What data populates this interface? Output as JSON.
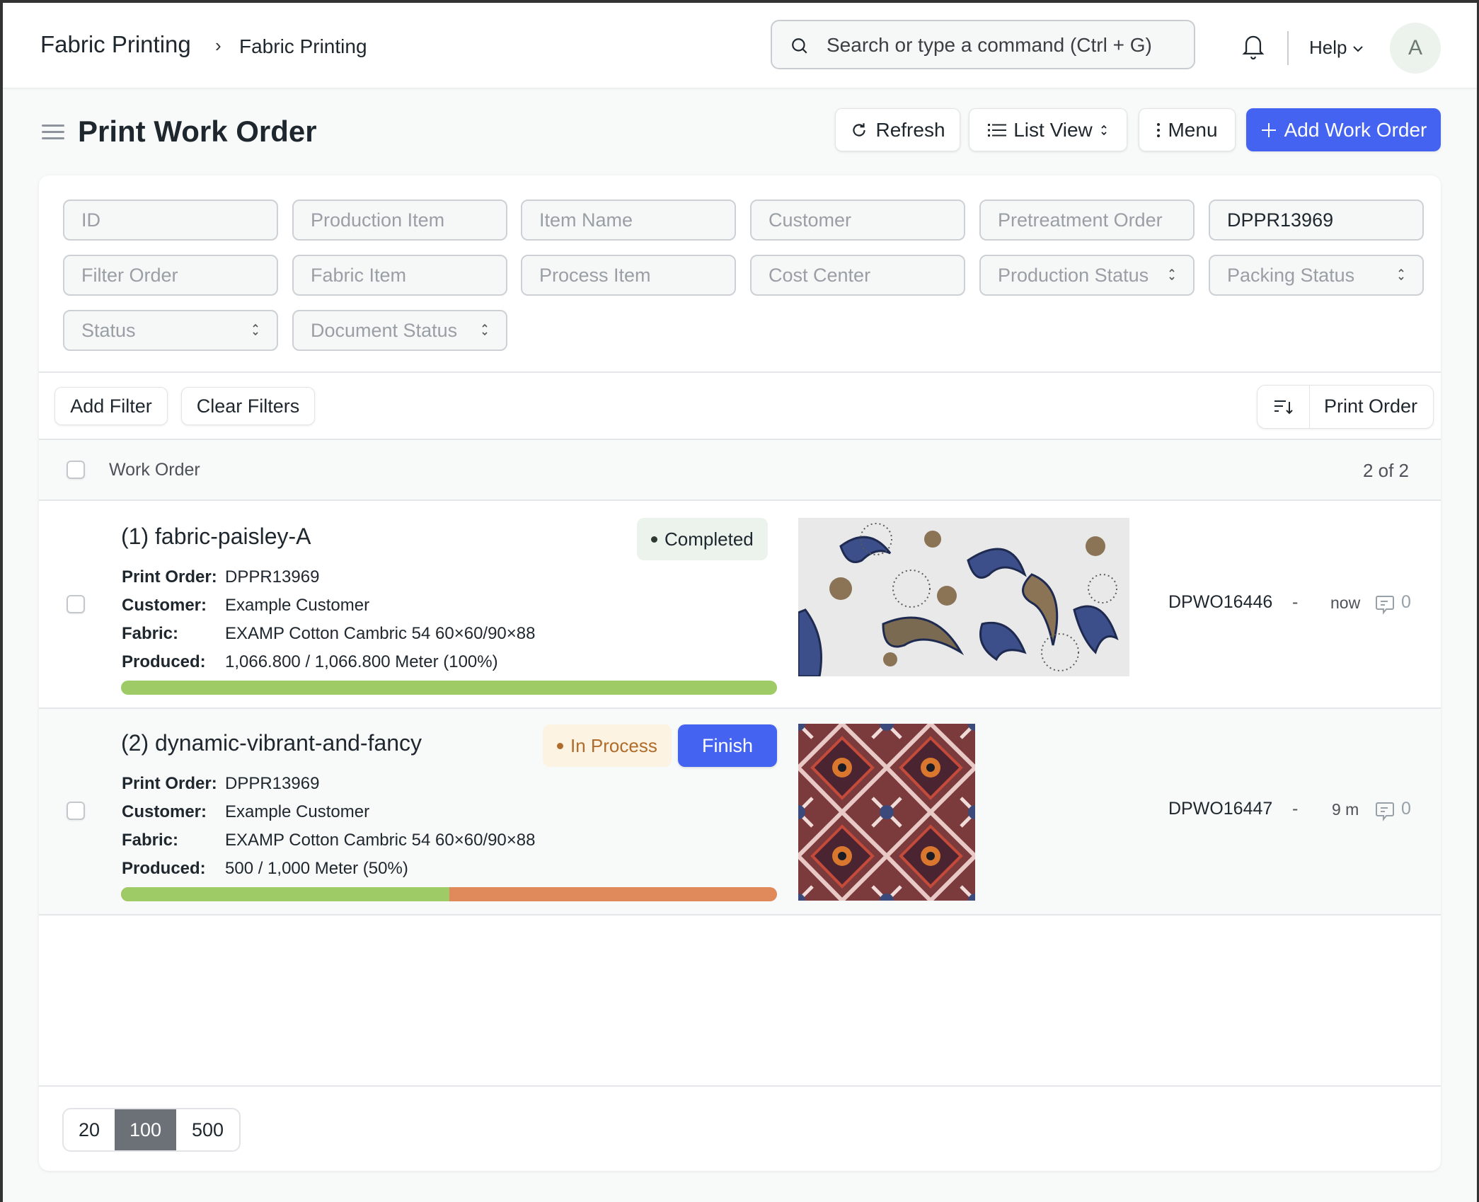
{
  "navbar": {
    "breadcrumbs": [
      "Fabric Printing",
      "Fabric Printing"
    ],
    "breadcrumb_separator": "›",
    "search_placeholder": "Search or type a command (Ctrl + G)",
    "help_label": "Help",
    "avatar_initial": "A"
  },
  "page": {
    "title": "Print Work Order",
    "buttons": {
      "refresh": "Refresh",
      "list_view": "List View",
      "menu": "Menu",
      "add": "Add Work Order"
    }
  },
  "filters": {
    "fields": [
      {
        "placeholder": "ID",
        "value": "",
        "type": "text"
      },
      {
        "placeholder": "Production Item",
        "value": "",
        "type": "text"
      },
      {
        "placeholder": "Item Name",
        "value": "",
        "type": "text"
      },
      {
        "placeholder": "Customer",
        "value": "",
        "type": "text"
      },
      {
        "placeholder": "Pretreatment Order",
        "value": "",
        "type": "text"
      },
      {
        "placeholder": "Print Order",
        "value": "DPPR13969",
        "type": "text"
      },
      {
        "placeholder": "Filter Order",
        "value": "",
        "type": "text"
      },
      {
        "placeholder": "Fabric Item",
        "value": "",
        "type": "text"
      },
      {
        "placeholder": "Process Item",
        "value": "",
        "type": "text"
      },
      {
        "placeholder": "Cost Center",
        "value": "",
        "type": "text"
      },
      {
        "placeholder": "Production Status",
        "value": "",
        "type": "select"
      },
      {
        "placeholder": "Packing Status",
        "value": "",
        "type": "select"
      },
      {
        "placeholder": "Status",
        "value": "",
        "type": "select"
      },
      {
        "placeholder": "Document Status",
        "value": "",
        "type": "select"
      }
    ],
    "add_filter": "Add Filter",
    "clear_filters": "Clear Filters",
    "sort_by": "Print Order"
  },
  "list": {
    "header_label": "Work Order",
    "count": "2 of 2",
    "labels": {
      "print_order": "Print Order:",
      "customer": "Customer:",
      "fabric": "Fabric:",
      "produced": "Produced:"
    },
    "rows": [
      {
        "title": "(1) fabric-paisley-A",
        "status": "Completed",
        "status_color": "#ebf3ec",
        "print_order": "DPPR13969",
        "customer": "Example Customer",
        "fabric": "EXAMP Cotton Cambric 54 60×60/90×88",
        "produced": "1,066.800 / 1,066.800 Meter (100%)",
        "progress_percent": 100,
        "image": "paisley-fabric-image",
        "id": "DPWO16446",
        "dash": "-",
        "modified": "now",
        "comments": "0"
      },
      {
        "title": "(2) dynamic-vibrant-and-fancy",
        "status": "In Process",
        "status_color": "#fcf3e2",
        "action": "Finish",
        "print_order": "DPPR13969",
        "customer": "Example Customer",
        "fabric": "EXAMP Cotton Cambric 54 60×60/90×88",
        "produced": "500 / 1,000 Meter (50%)",
        "progress_percent": 50,
        "image": "kaleidoscope-fabric-image",
        "id": "DPWO16447",
        "dash": "-",
        "modified": "9 m",
        "comments": "0"
      }
    ]
  },
  "paging": {
    "options": [
      "20",
      "100",
      "500"
    ],
    "selected": "100"
  },
  "colors": {
    "primary": "#4463f0",
    "progress_done": "#9ecb66",
    "progress_remaining": "#e08a5c"
  }
}
